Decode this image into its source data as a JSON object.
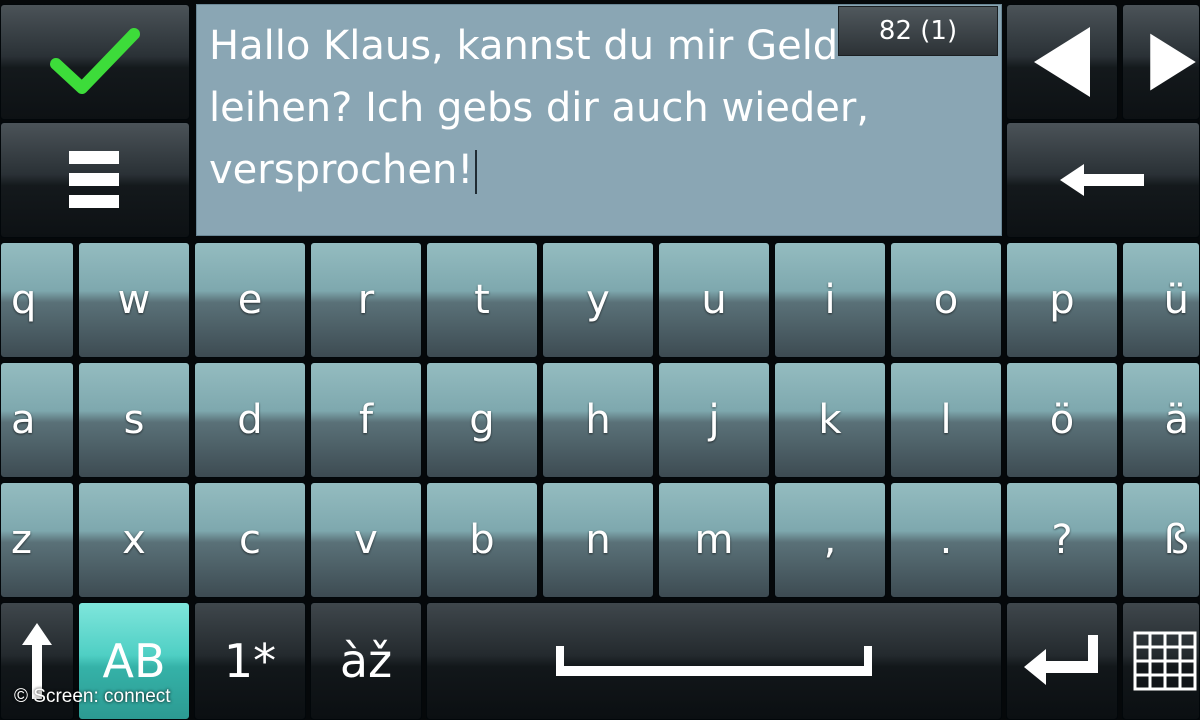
{
  "message": {
    "text": "Hallo Klaus, kannst du mir Geld leihen? Ich gebs dir auch wieder, versprochen!",
    "counter": "82 (1)"
  },
  "keyboard": {
    "row1": [
      "q",
      "w",
      "e",
      "r",
      "t",
      "y",
      "u",
      "i",
      "o",
      "p",
      "ü"
    ],
    "row2": [
      "a",
      "s",
      "d",
      "f",
      "g",
      "h",
      "j",
      "k",
      "l",
      "ö",
      "ä"
    ],
    "row3": [
      "z",
      "x",
      "c",
      "v",
      "b",
      "n",
      "m",
      ",",
      ".",
      "?",
      "ß"
    ]
  },
  "bottom_row": {
    "case_label": "AB",
    "numbers_label": "1*",
    "accents_label": "àž"
  },
  "icons": {
    "confirm": "check-icon",
    "menu": "menu-icon",
    "left": "arrow-left-icon",
    "right": "arrow-right-icon",
    "backspace": "backspace-icon",
    "shift": "shift-icon",
    "space": "space-icon",
    "enter": "enter-icon",
    "keyboard": "keyboard-icon"
  },
  "colors": {
    "text_field": "#8aa6b4",
    "check": "#3ddc3a",
    "active_case": "#4fcfc4"
  },
  "copyright": "© Screen: connect"
}
